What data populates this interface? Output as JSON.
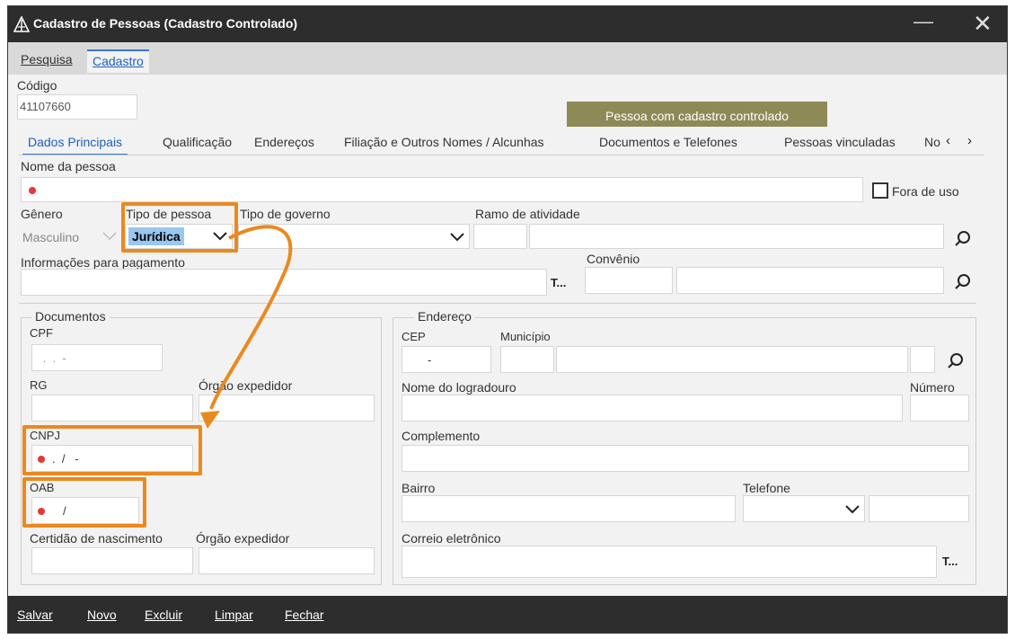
{
  "window": {
    "title": "Cadastro de Pessoas (Cadastro Controlado)"
  },
  "top_tabs": [
    {
      "label": "Pesquisa"
    },
    {
      "label": "Cadastro"
    }
  ],
  "codigo": {
    "label": "Código",
    "value": "41107660"
  },
  "banner": {
    "text": "Pessoa com cadastro controlado",
    "color": "#8d8a57"
  },
  "subtabs": [
    {
      "label": "Dados Principais"
    },
    {
      "label": "Qualificação"
    },
    {
      "label": "Endereços"
    },
    {
      "label": "Filiação e Outros Nomes / Alcunhas"
    },
    {
      "label": "Documentos e Telefones"
    },
    {
      "label": "Pessoas vinculadas"
    },
    {
      "label": "No"
    }
  ],
  "nome": {
    "label": "Nome da pessoa",
    "value": ""
  },
  "fora_de_uso": {
    "label": "Fora de uso",
    "checked": false
  },
  "genero": {
    "label": "Gênero",
    "value": "Masculino"
  },
  "tipo_pessoa": {
    "label": "Tipo de pessoa",
    "value": "Jurídica"
  },
  "tipo_governo": {
    "label": "Tipo de governo",
    "value": ""
  },
  "ramo": {
    "label": "Ramo de atividade"
  },
  "info_pagamento": {
    "label": "Informações para pagamento",
    "button": "T..."
  },
  "convenio": {
    "label": "Convênio"
  },
  "documentos": {
    "title": "Documentos",
    "cpf": {
      "label": "CPF",
      "mask": " .  .  -"
    },
    "rg": {
      "label": "RG"
    },
    "orgao1": {
      "label": "Órgão expedidor"
    },
    "cnpj": {
      "label": "CNPJ",
      "mask": ".  /   -"
    },
    "oab": {
      "label": "OAB",
      "mask": "/"
    },
    "certidao": {
      "label": "Certidão de nascimento"
    },
    "orgao2": {
      "label": "Órgão expedidor"
    }
  },
  "endereco": {
    "title": "Endereço",
    "cep": {
      "label": "CEP",
      "mask": "-"
    },
    "municipio": {
      "label": "Município"
    },
    "logradouro": {
      "label": "Nome do logradouro"
    },
    "numero": {
      "label": "Número"
    },
    "complemento": {
      "label": "Complemento"
    },
    "bairro": {
      "label": "Bairro"
    },
    "telefone": {
      "label": "Telefone"
    },
    "email": {
      "label": "Correio eletrônico",
      "button": "T..."
    }
  },
  "bottom": [
    {
      "label": "Salvar"
    },
    {
      "label": "Novo"
    },
    {
      "label": "Excluir"
    },
    {
      "label": "Limpar"
    },
    {
      "label": "Fechar"
    }
  ],
  "colors": {
    "annotation": "#e98a1f",
    "required": "#e53935",
    "titlebar": "#2d2d2d",
    "accent": "#3b78d8"
  }
}
